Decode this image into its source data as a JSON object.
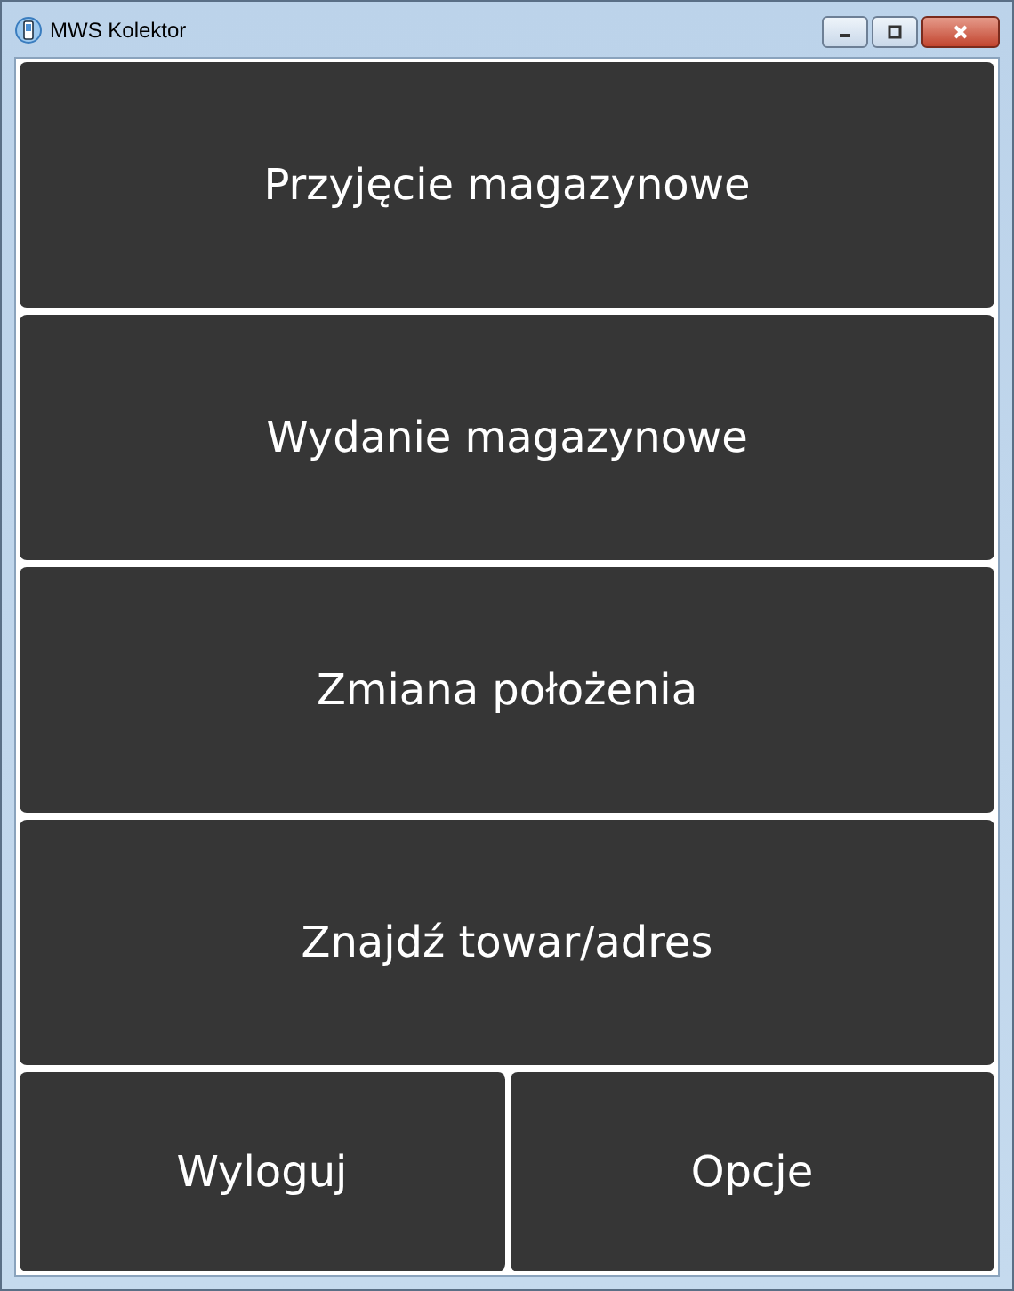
{
  "window": {
    "title": "MWS Kolektor"
  },
  "menu_buttons": [
    {
      "label": "Przyjęcie magazynowe"
    },
    {
      "label": "Wydanie magazynowe"
    },
    {
      "label": "Zmiana położenia"
    },
    {
      "label": "Znajdź towar/adres"
    }
  ],
  "bottom_buttons": [
    {
      "label": "Wyloguj"
    },
    {
      "label": "Opcje"
    }
  ]
}
